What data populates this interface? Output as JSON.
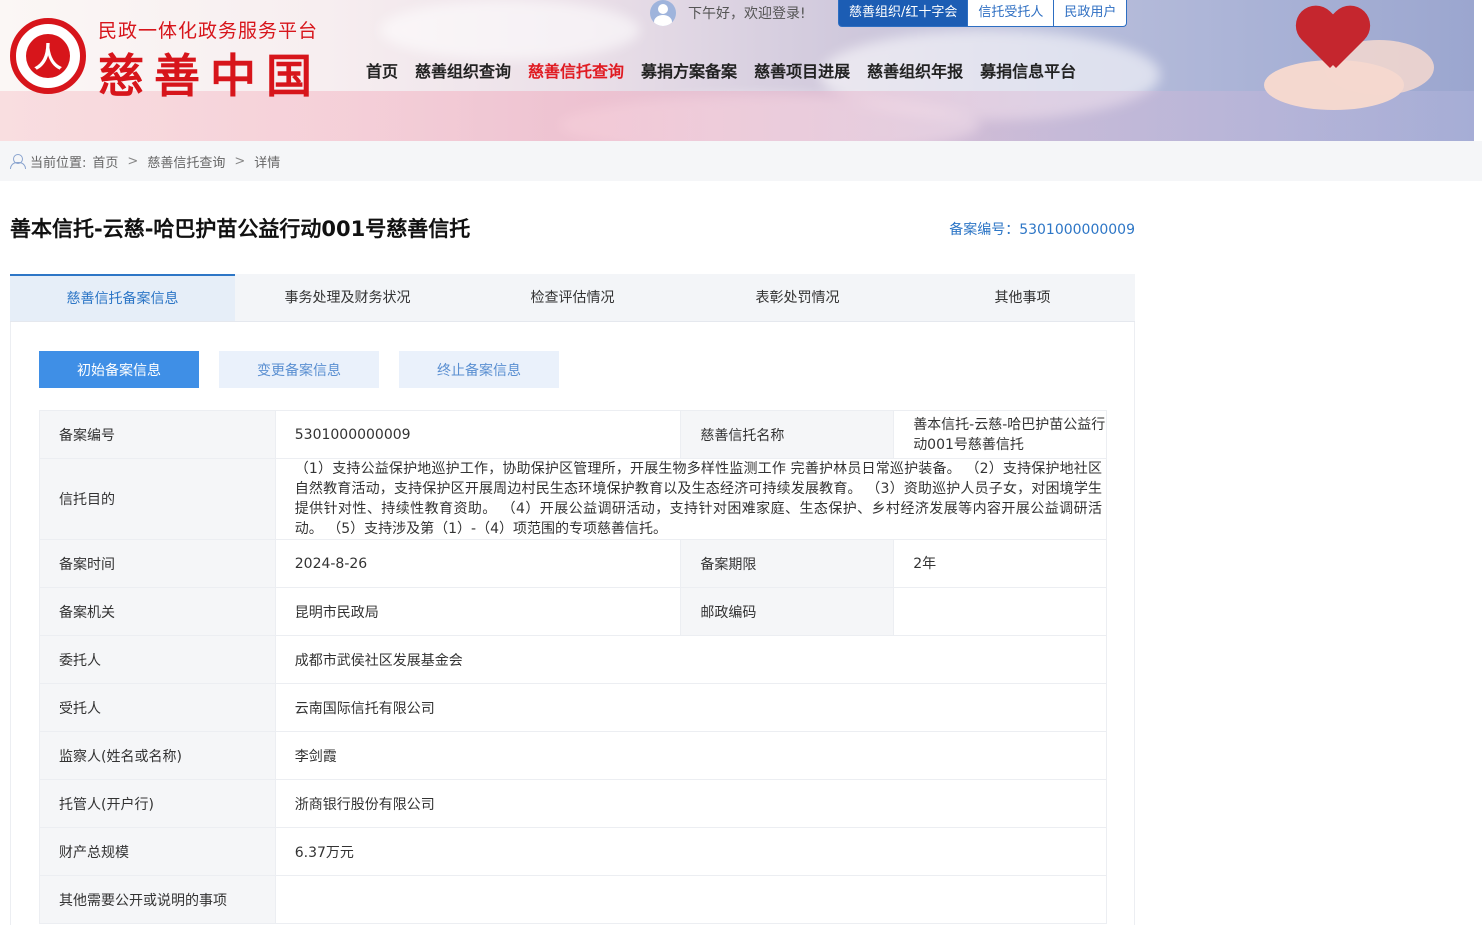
{
  "header": {
    "site_subtitle": "民政一体化政务服务平台",
    "site_title": "慈善中国",
    "greeting": "下午好，欢迎登录!",
    "login_tabs": [
      "慈善组织/红十字会",
      "信托受托人",
      "民政用户"
    ],
    "nav": [
      "首页",
      "慈善组织查询",
      "慈善信托查询",
      "募捐方案备案",
      "慈善项目进展",
      "慈善组织年报",
      "募捐信息平台"
    ],
    "nav_active_index": 2
  },
  "breadcrumb": {
    "prefix": "当前位置:",
    "items": [
      "首页",
      "慈善信托查询",
      "详情"
    ]
  },
  "page": {
    "title": "善本信托-云慈-哈巴护苗公益行动001号慈善信托",
    "record_no_text": "备案编号：5301000000009"
  },
  "tabs": [
    "慈善信托备案信息",
    "事务处理及财务状况",
    "检查评估情况",
    "表彰处罚情况",
    "其他事项"
  ],
  "sub_buttons": [
    "初始备案信息",
    "变更备案信息",
    "终止备案信息"
  ],
  "info": {
    "record_no_label": "备案编号",
    "record_no": "5301000000009",
    "trust_name_label": "慈善信托名称",
    "trust_name": "善本信托-云慈-哈巴护苗公益行动001号慈善信托",
    "purpose_label": "信托目的",
    "purpose": "（1）支持公益保护地巡护工作，协助保护区管理所，开展生物多样性监测工作 完善护林员日常巡护装备。 （2）支持保护地社区自然教育活动，支持保护区开展周边村民生态环境保护教育以及生态经济可持续发展教育。 （3）资助巡护人员子女，对困境学生提供针对性、持续性教育资助。 （4）开展公益调研活动，支持针对困难家庭、生态保护、乡村经济发展等内容开展公益调研活动。 （5）支持涉及第（1）-（4）项范围的专项慈善信托。",
    "record_date_label": "备案时间",
    "record_date": "2024-8-26",
    "record_period_label": "备案期限",
    "record_period": "2年",
    "authority_label": "备案机关",
    "authority": "昆明市民政局",
    "postcode_label": "邮政编码",
    "postcode": "",
    "settlor_label": "委托人",
    "settlor": "成都市武侯社区发展基金会",
    "trustee_label": "受托人",
    "trustee": "云南国际信托有限公司",
    "supervisor_label": "监察人(姓名或名称)",
    "supervisor": "李剑霞",
    "custodian_label": "托管人(开户行)",
    "custodian": "浙商银行股份有限公司",
    "property_label": "财产总规模",
    "property": "6.37万元",
    "other_label": "其他需要公开或说明的事项",
    "other": ""
  },
  "colors": {
    "brand_red": "#d7151b",
    "nav_active": "#e01b22",
    "link_blue": "#2d76c6",
    "button_blue": "#3f8fe6"
  }
}
